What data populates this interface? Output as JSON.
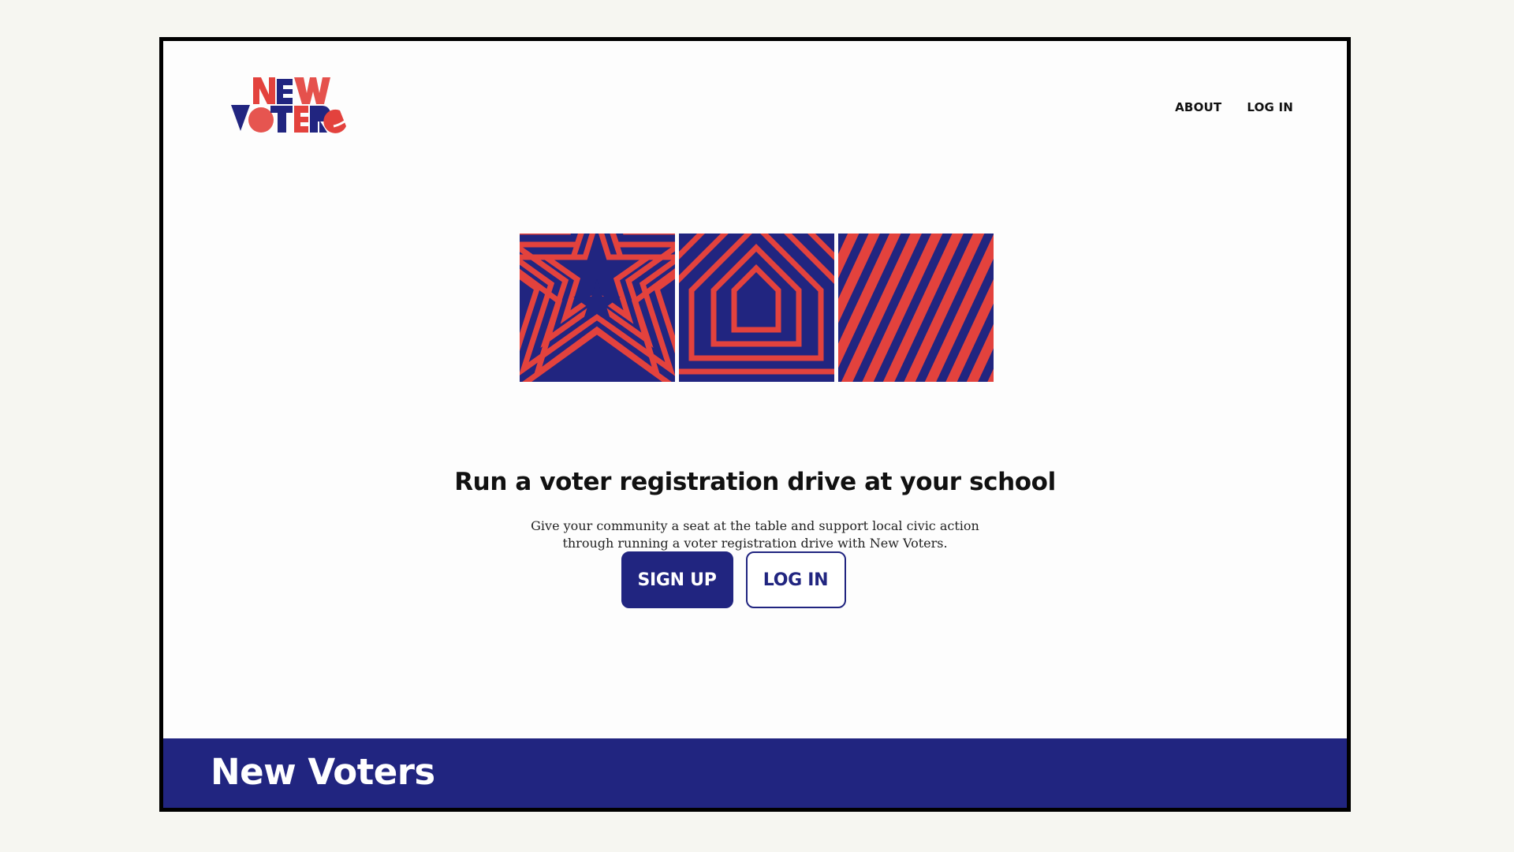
{
  "brand": {
    "logo_line1": "NEW",
    "logo_line2": "VOTERS",
    "name": "New Voters"
  },
  "nav": {
    "items": [
      "ABOUT",
      "LOG IN"
    ]
  },
  "hero": {
    "headline": "Run a voter registration drive at your school",
    "subtext_line1": "Give your community a seat at the table and support local civic action",
    "subtext_line2": "through running a voter registration drive with New Voters.",
    "tiles": [
      "star-pattern-icon",
      "arrow-pattern-icon",
      "diagonal-stripes-icon"
    ]
  },
  "buttons": {
    "signup": "SIGN UP",
    "login": "LOG IN"
  },
  "colors": {
    "navy": "#212580",
    "red": "#e3423d",
    "frame": "#000000",
    "background": "#f6f6f1"
  }
}
